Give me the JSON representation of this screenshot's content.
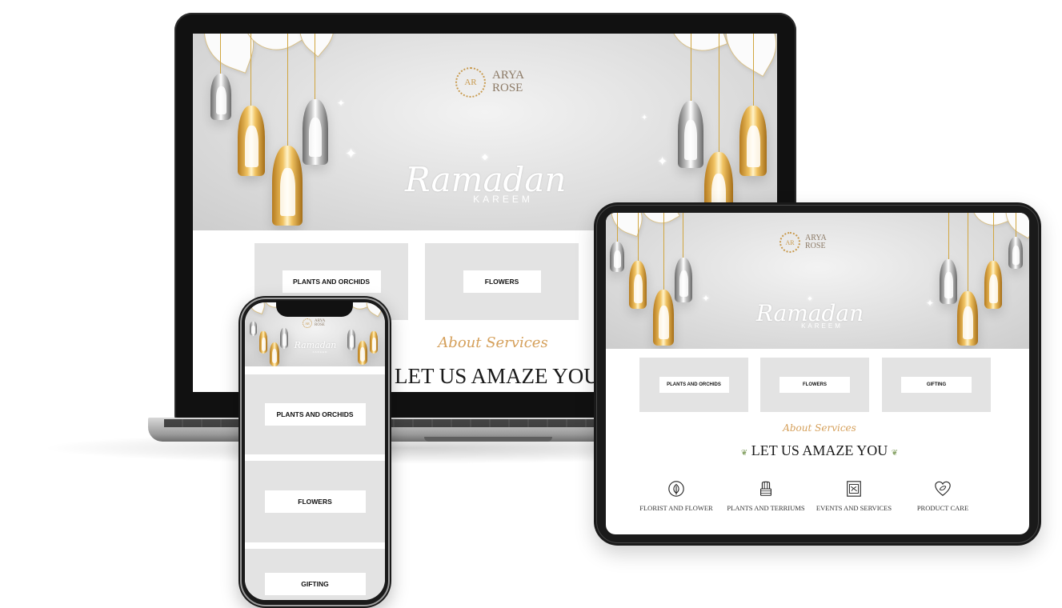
{
  "brand": {
    "name_line1": "ARYA",
    "name_line2": "ROSE",
    "mark": "AR"
  },
  "banner": {
    "title": "Ramadan",
    "subtitle": "KAREEM"
  },
  "cards": [
    "PLANTS AND ORCHIDS",
    "FLOWERS",
    "GIFTING"
  ],
  "about": {
    "script": "About Services",
    "headline": "LET US AMAZE YOU"
  },
  "services": [
    {
      "icon": "leaf-icon",
      "label": "FLORIST AND FLOWER"
    },
    {
      "icon": "cactus-icon",
      "label": "PLANTS AND TERRIUMS"
    },
    {
      "icon": "event-box-icon",
      "label": "EVENTS AND SERVICES"
    },
    {
      "icon": "heart-leaf-icon",
      "label": "PRODUCT CARE"
    }
  ],
  "colors": {
    "gold": "#d5a05b",
    "card_bg": "#e3e3e3",
    "banner_bg": "#dcdcdc",
    "text_dark": "#1a1a1a"
  }
}
